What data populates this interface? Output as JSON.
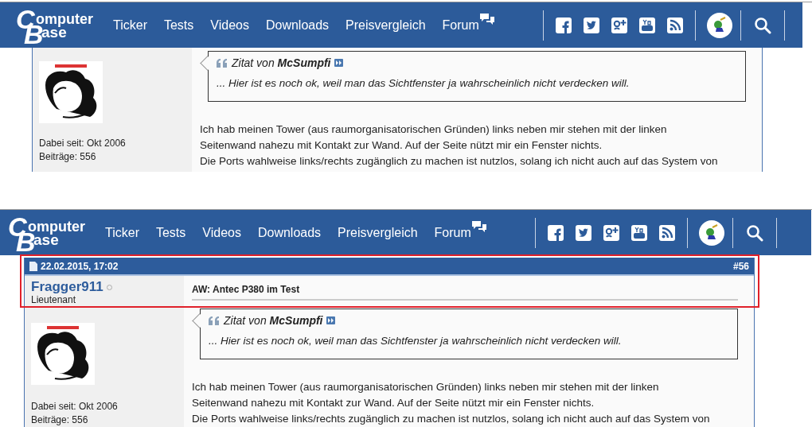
{
  "captures": [
    {
      "navbar": {
        "logo": {
          "initial_top": "C",
          "top": "omputer",
          "initial_bottom": "B",
          "bottom": "ase"
        },
        "links": [
          {
            "label": "Ticker",
            "kind": "plain"
          },
          {
            "label": "Tests",
            "kind": "plain"
          },
          {
            "label": "Videos",
            "kind": "plain"
          },
          {
            "label": "Downloads",
            "kind": "plain"
          },
          {
            "label": "Preisvergleich",
            "kind": "plain"
          },
          {
            "label": "Forum",
            "kind": "chat"
          }
        ]
      },
      "post": {
        "joined": "Dabei seit: Okt 2006",
        "posts": "Beiträge: 556",
        "quote": {
          "label": "Zitat von",
          "author": "McSumpfi",
          "text": "... Hier ist es noch ok, weil man das Sichtfenster ja wahrscheinlich nicht verdecken will."
        },
        "body_lines": [
          "Ich hab meinen Tower (aus raumorganisatorischen Gründen) links neben mir stehen mit der linken",
          "Seitenwand nahezu mit Kontakt zur Wand. Auf der Seite nützt mir ein Fenster nichts.",
          "Die Ports wahlweise links/rechts zugänglich zu machen ist nutzlos, solang ich nicht auch auf das System von"
        ]
      }
    },
    {
      "highlight": true,
      "navbar": {
        "logo": {
          "initial_top": "C",
          "top": "omputer",
          "initial_bottom": "B",
          "bottom": "ase"
        },
        "links": [
          {
            "label": "Ticker",
            "kind": "plain"
          },
          {
            "label": "Tests",
            "kind": "plain"
          },
          {
            "label": "Videos",
            "kind": "plain"
          },
          {
            "label": "Downloads",
            "kind": "plain"
          },
          {
            "label": "Preisvergleich",
            "kind": "plain"
          },
          {
            "label": "Forum",
            "kind": "chat"
          }
        ]
      },
      "post": {
        "header": {
          "date": "22.02.2015, 17:02",
          "number": "#56"
        },
        "author": "Fragger911",
        "online": false,
        "rank": "Lieutenant",
        "title": "AW: Antec P380 im Test",
        "joined": "Dabei seit: Okt 2006",
        "posts": "Beiträge: 556",
        "quote": {
          "label": "Zitat von",
          "author": "McSumpfi",
          "text": "... Hier ist es noch ok, weil man das Sichtfenster ja wahrscheinlich nicht verdecken will."
        },
        "body_lines": [
          "Ich hab meinen Tower (aus raumorganisatorischen Gründen) links neben mir stehen mit der linken",
          "Seitenwand nahezu mit Kontakt zur Wand. Auf der Seite nützt mir ein Fenster nichts.",
          "Die Ports wahlweise links/rechts zugänglich zu machen ist nutzlos, solang ich nicht auch auf das System von"
        ]
      }
    }
  ]
}
